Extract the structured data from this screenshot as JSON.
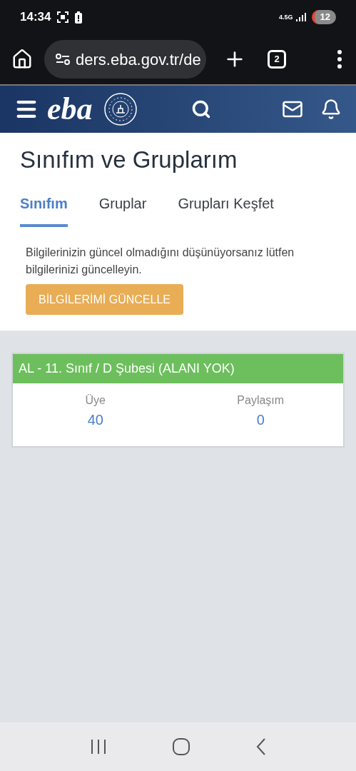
{
  "status_bar": {
    "time": "14:34",
    "network": "4.5G",
    "battery": "12"
  },
  "browser": {
    "url": "ders.eba.gov.tr/de",
    "tab_count": "2"
  },
  "header": {
    "logo": "eba"
  },
  "page": {
    "title": "Sınıfım ve Gruplarım"
  },
  "tabs": [
    {
      "label": "Sınıfım",
      "selected": true
    },
    {
      "label": "Gruplar",
      "selected": false
    },
    {
      "label": "Grupları Keşfet",
      "selected": false
    }
  ],
  "notice": {
    "text": "Bilgilerinizin güncel olmadığını düşünüyorsanız lütfen bilgilerinizi güncelleyin.",
    "button": "BİLGİLERİMİ GÜNCELLE"
  },
  "classes": [
    {
      "name": "AL - 11. Sınıf / D Şubesi (ALANI YOK)",
      "color": "#6cbf5c",
      "stats": [
        {
          "label": "Üye",
          "value": "40"
        },
        {
          "label": "Paylaşım",
          "value": "0"
        }
      ]
    }
  ]
}
